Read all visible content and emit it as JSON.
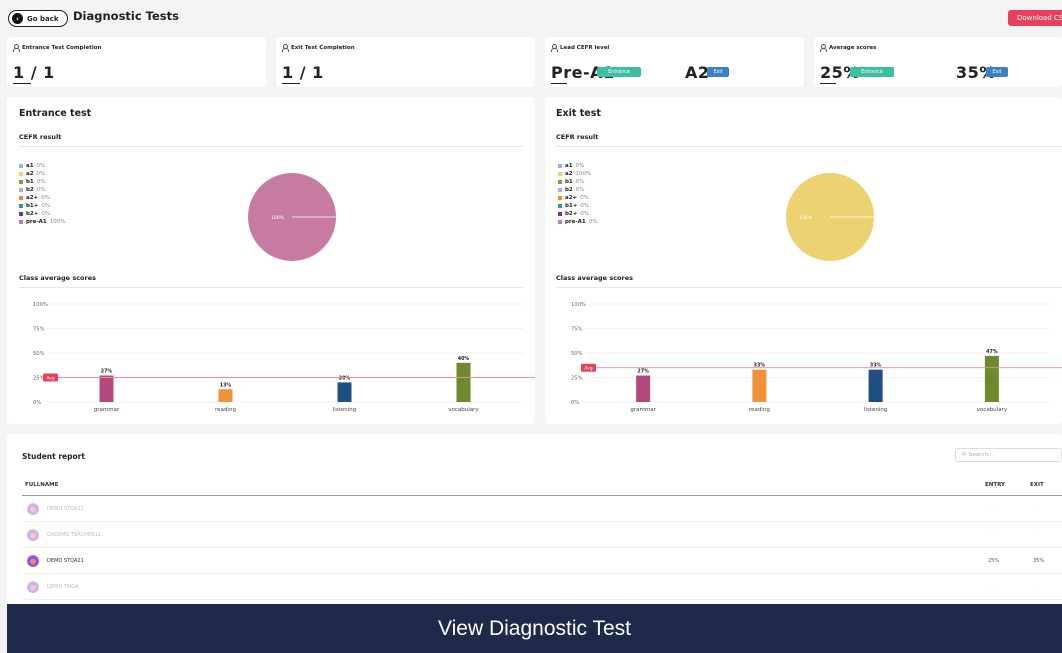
{
  "header": {
    "go_back": "Go back",
    "title": "Diagnostic Tests",
    "download": "Download CSV"
  },
  "stats": {
    "entrance_completion": {
      "label": "Entrance Test Completion",
      "value": "1 / 1"
    },
    "exit_completion": {
      "label": "Exit Test Completion",
      "value": "1 / 1"
    },
    "lead_cefr": {
      "label": "Lead CEFR level",
      "entrance_value": "Pre-A1",
      "entrance_badge": "Entrance",
      "exit_value": "A2",
      "exit_badge": "Exit"
    },
    "average": {
      "label": "Average scores",
      "entrance_value": "25%",
      "entrance_badge": "Entrance",
      "exit_value": "35%",
      "exit_badge": "Exit"
    }
  },
  "entrance": {
    "title": "Entrance test",
    "cefr_title": "CEFR result",
    "scores_title": "Class average scores",
    "legend": [
      {
        "name": "a1",
        "pct": "0%",
        "color": "#8fb5e0"
      },
      {
        "name": "a2",
        "pct": "0%",
        "color": "#ecd270"
      },
      {
        "name": "b1",
        "pct": "0%",
        "color": "#7ea33a"
      },
      {
        "name": "b2",
        "pct": "0%",
        "color": "#9ab8d8"
      },
      {
        "name": "a2+",
        "pct": "0%",
        "color": "#f08a30"
      },
      {
        "name": "b1+",
        "pct": "0%",
        "color": "#2a9d8f"
      },
      {
        "name": "b2+",
        "pct": "0%",
        "color": "#6a35b0"
      },
      {
        "name": "pre-A1",
        "pct": "100%",
        "color": "#c77ba1"
      }
    ],
    "pie_label": "100%",
    "pie_color": "#c77ba1"
  },
  "exit": {
    "title": "Exit test",
    "cefr_title": "CEFR result",
    "scores_title": "Class average scores",
    "legend": [
      {
        "name": "a1",
        "pct": "0%",
        "color": "#8fb5e0"
      },
      {
        "name": "a2",
        "pct": "100%",
        "color": "#ecd270"
      },
      {
        "name": "b1",
        "pct": "0%",
        "color": "#7ea33a"
      },
      {
        "name": "b2",
        "pct": "0%",
        "color": "#9ab8d8"
      },
      {
        "name": "a2+",
        "pct": "0%",
        "color": "#f08a30"
      },
      {
        "name": "b1+",
        "pct": "0%",
        "color": "#2a9d8f"
      },
      {
        "name": "b2+",
        "pct": "0%",
        "color": "#6a35b0"
      },
      {
        "name": "pre-A1",
        "pct": "0%",
        "color": "#c77ba1"
      }
    ],
    "pie_label": "100%",
    "pie_color": "#ecd270"
  },
  "chart_data": [
    {
      "type": "pie",
      "labels": [
        "a1",
        "a2",
        "b1",
        "b2",
        "a2+",
        "b1+",
        "b2+",
        "pre-A1"
      ],
      "values": [
        0,
        0,
        0,
        0,
        0,
        0,
        0,
        100
      ],
      "title": "CEFR result"
    },
    {
      "type": "bar",
      "title": "Class average scores",
      "categories": [
        "grammar",
        "reading",
        "listening",
        "vocabulary"
      ],
      "values": [
        27,
        13,
        20,
        40
      ],
      "value_labels": [
        "27%",
        "13%",
        "20%",
        "40%"
      ],
      "colors": [
        "#b34a7e",
        "#f0923a",
        "#1f4f82",
        "#6f8a2e"
      ],
      "ylim": [
        0,
        100
      ],
      "yticks": [
        "0%",
        "25%",
        "50%",
        "75%",
        "100%"
      ],
      "avg": 25,
      "avg_label": "Avg"
    },
    {
      "type": "pie",
      "labels": [
        "a1",
        "a2",
        "b1",
        "b2",
        "a2+",
        "b1+",
        "b2+",
        "pre-A1"
      ],
      "values": [
        0,
        100,
        0,
        0,
        0,
        0,
        0,
        0
      ],
      "title": "CEFR result"
    },
    {
      "type": "bar",
      "title": "Class average scores",
      "categories": [
        "grammar",
        "reading",
        "listening",
        "vocabulary"
      ],
      "values": [
        27,
        33,
        33,
        47
      ],
      "value_labels": [
        "27%",
        "33%",
        "33%",
        "47%"
      ],
      "colors": [
        "#b34a7e",
        "#f0923a",
        "#1f4f82",
        "#6f8a2e"
      ],
      "ylim": [
        0,
        100
      ],
      "yticks": [
        "0%",
        "25%",
        "50%",
        "75%",
        "100%"
      ],
      "avg": 35,
      "avg_label": "Avg"
    }
  ],
  "report": {
    "title": "Student report",
    "search_placeholder": "Search...",
    "col_fullname": "FULLNAME",
    "col_entry": "ENTRY",
    "col_exit": "EXIT",
    "rows": [
      {
        "name": "DEMO STQA22",
        "entry": "-",
        "exit": "-"
      },
      {
        "name": "GADEMO TEACHER11",
        "entry": "-",
        "exit": "-"
      },
      {
        "name": "DEMO STQA21",
        "entry": "25%",
        "exit": "35%"
      },
      {
        "name": "DEMO TMGA",
        "entry": "-",
        "exit": "-"
      }
    ]
  },
  "footer": {
    "label": "View Diagnostic Test"
  }
}
